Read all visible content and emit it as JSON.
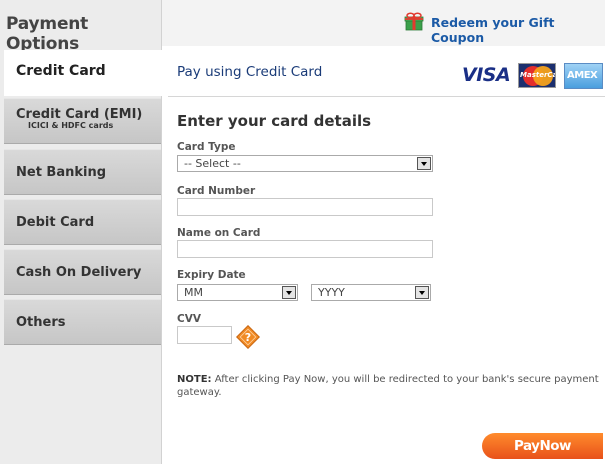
{
  "sidebar": {
    "title": "Payment Options",
    "items": [
      {
        "label": "Credit Card",
        "active": true
      },
      {
        "label": "Credit Card (EMI)",
        "sub": "ICICI & HDFC cards"
      },
      {
        "label": "Net Banking"
      },
      {
        "label": "Debit Card"
      },
      {
        "label": "Cash On Delivery"
      },
      {
        "label": "Others"
      }
    ]
  },
  "header": {
    "redeem_label": "Redeem your Gift Coupon",
    "gift_icon": "gift-icon"
  },
  "panel": {
    "title": "Pay using Credit Card",
    "card_logos": {
      "visa": "VISA",
      "mastercard": "MasterCard",
      "amex": "AMEX"
    },
    "heading": "Enter your card details"
  },
  "form": {
    "card_type_label": "Card Type",
    "card_type_value": "-- Select --",
    "card_number_label": "Card Number",
    "card_number_value": "",
    "name_label": "Name on Card",
    "name_value": "",
    "expiry_label": "Expiry Date",
    "expiry_month": "MM",
    "expiry_year": "YYYY",
    "cvv_label": "CVV",
    "cvv_value": ""
  },
  "note": {
    "prefix": "NOTE:",
    "text": " After clicking Pay Now, you will be redirected to your bank's secure payment gateway."
  },
  "actions": {
    "pay_label": "PayNow"
  },
  "colors": {
    "accent_blue": "#1b5aa6",
    "pay_orange": "#f06d22",
    "sidebar_bg": "#ececec"
  }
}
